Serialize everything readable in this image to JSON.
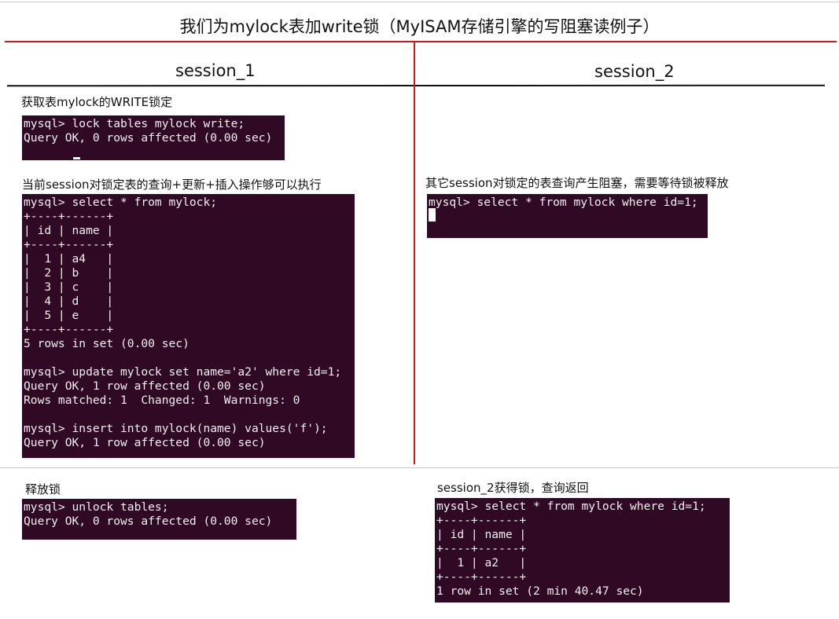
{
  "page": {
    "title": "我们为mylock表加write锁（MyISAM存储引擎的写阻塞读例子）"
  },
  "sessions": {
    "left_label": "session_1",
    "right_label": "session_2"
  },
  "steps": {
    "s1_lock": {
      "caption": "获取表mylock的WRITE锁定",
      "terminal": "mysql> lock tables mylock write;\nQuery OK, 0 rows affected (0.00 sec)"
    },
    "s1_ops": {
      "caption": "当前session对锁定表的查询+更新+插入操作够可以执行",
      "terminal": "mysql> select * from mylock;\n+----+------+\n| id | name |\n+----+------+\n|  1 | a4   |\n|  2 | b    |\n|  3 | c    |\n|  4 | d    |\n|  5 | e    |\n+----+------+\n5 rows in set (0.00 sec)\n\nmysql> update mylock set name='a2' where id=1;\nQuery OK, 1 row affected (0.00 sec)\nRows matched: 1  Changed: 1  Warnings: 0\n\nmysql> insert into mylock(name) values('f');\nQuery OK, 1 row affected (0.00 sec)"
    },
    "s2_blocked": {
      "caption": "其它session对锁定的表查询产生阻塞，需要等待锁被释放",
      "terminal": "mysql> select * from mylock where id=1;"
    },
    "s1_unlock": {
      "caption": "释放锁",
      "terminal": "mysql> unlock tables;\nQuery OK, 0 rows affected (0.00 sec)"
    },
    "s2_result": {
      "caption": "session_2获得锁，查询返回",
      "terminal": "mysql> select * from mylock where id=1;\n+----+------+\n| id | name |\n+----+------+\n|  1 | a2   |\n+----+------+\n1 row in set (2 min 40.47 sec)"
    }
  },
  "colors": {
    "terminal_bg": "#300a24",
    "terminal_fg": "#f0f0f0",
    "divider_red": "#d01818",
    "divider_black": "#111111",
    "divider_gray": "#c8c8c8"
  }
}
